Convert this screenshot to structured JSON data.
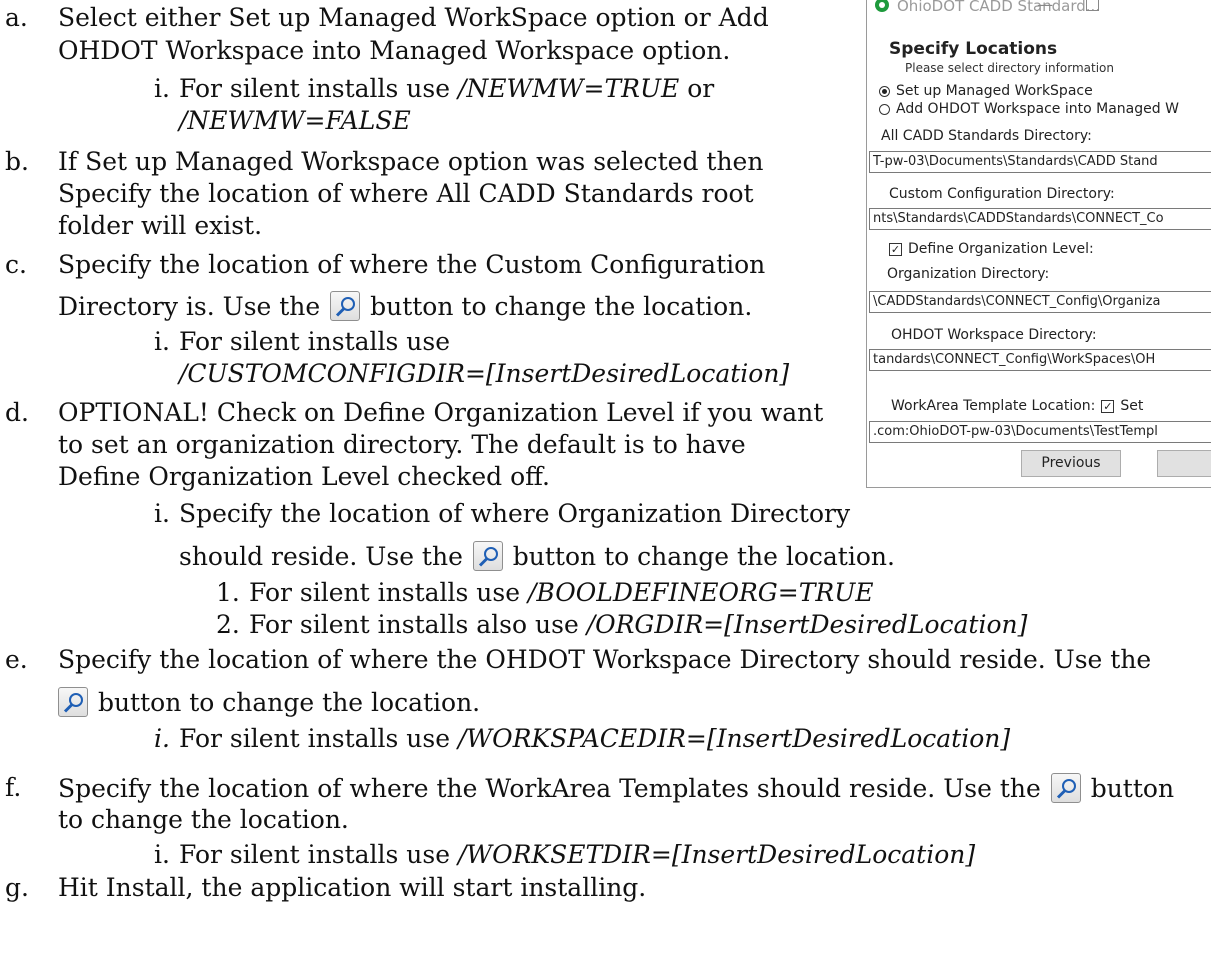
{
  "steps": {
    "a": {
      "marker": "a.",
      "line1": "Select either Set up Managed WorkSpace option or Add",
      "line2": "OHDOT Workspace into Managed Workspace option."
    },
    "a_i": {
      "marker": "i.",
      "prefix": "For silent installs use ",
      "code1": "/NEWMW=TRUE",
      "mid": " or",
      "code2": "/NEWMW=FALSE"
    },
    "b": {
      "marker": "b.",
      "line1": "If Set up Managed Workspace option was selected then",
      "line2": "Specify the location of where All CADD Standards root",
      "line3": "folder will exist."
    },
    "c": {
      "marker": "c.",
      "line1": "Specify the location of where the Custom Configuration",
      "line2a": "Directory is. Use the ",
      "line2b": " button to change the location."
    },
    "c_i": {
      "marker": "i.",
      "text": "For silent installs use",
      "code": "/CUSTOMCONFIGDIR=[InsertDesiredLocation]"
    },
    "d": {
      "marker": "d.",
      "line1": "OPTIONAL! Check on Define Organization Level if you want",
      "line2": "to set an organization directory. The default is to have",
      "line3": "Define Organization Level checked off."
    },
    "d_i": {
      "marker": "i.",
      "line1": "Specify the location of where Organization Directory",
      "line2a": "should reside. Use the ",
      "line2b": " button to change the location."
    },
    "d_i_1": {
      "marker": "1.",
      "prefix": "For silent installs use ",
      "code": "/BOOLDEFINEORG=TRUE"
    },
    "d_i_2": {
      "marker": "2.",
      "prefix": "For silent installs also use ",
      "code": "/ORGDIR=[InsertDesiredLocation]"
    },
    "e": {
      "marker": "e.",
      "line1": "Specify the location of where the OHDOT Workspace Directory should reside. Use the",
      "line2": " button to change the location."
    },
    "e_i": {
      "marker": "i.",
      "prefix": "For silent installs use ",
      "code": "/WORKSPACEDIR=[InsertDesiredLocation]"
    },
    "f": {
      "marker": "f.",
      "line1a": "Specify the location of where the WorkArea Templates should reside. Use the ",
      "line1b": " button",
      "line2": "to change the location."
    },
    "f_i": {
      "marker": "i.",
      "prefix": "For silent installs use ",
      "code": "/WORKSETDIR=[InsertDesiredLocation]"
    },
    "g": {
      "marker": "g.",
      "text": "Hit Install, the application will start installing."
    }
  },
  "dialog": {
    "title": "OhioDOT CADD Standard...",
    "minimize": "—",
    "heading": "Specify Locations",
    "subheading": "Please select directory information",
    "radio_setup": "Set up Managed WorkSpace",
    "radio_add": "Add OHDOT Workspace into Managed W",
    "all_cadd_label": "All CADD Standards Directory:",
    "all_cadd_value": "T-pw-03\\Documents\\Standards\\CADD Stand",
    "custom_config_label": "Custom Configuration Directory:",
    "custom_config_value": "nts\\Standards\\CADDStandards\\CONNECT_Co",
    "define_org_label": "Define Organization Level:",
    "org_dir_label": "Organization Directory:",
    "org_dir_value": "\\CADDStandards\\CONNECT_Config\\Organiza",
    "workspace_label": "OHDOT Workspace Directory:",
    "workspace_value": "tandards\\CONNECT_Config\\WorkSpaces\\OH",
    "template_label": "WorkArea Template Location:",
    "template_set": "Set",
    "template_value": ".com:OhioDOT-pw-03\\Documents\\TestTempl",
    "previous_button": "Previous",
    "next_button": "",
    "check_mark": "✓"
  },
  "icons": {
    "browse": "magnifier-browse-icon"
  }
}
